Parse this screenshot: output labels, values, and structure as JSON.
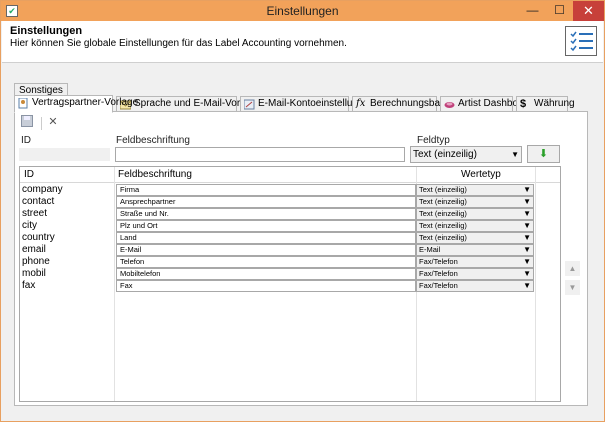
{
  "window": {
    "title": "Einstellungen",
    "minimize": "—",
    "maximize": "☐",
    "close": "✕"
  },
  "header": {
    "title": "Einstellungen",
    "subtitle": "Hier können Sie globale Einstellungen für das Label Accounting vornehmen."
  },
  "tabs": {
    "upper": "Sonstiges",
    "items": [
      {
        "label": "Vertragspartner-Vorlage",
        "icon": "contract-icon"
      },
      {
        "label": "Sprache und E-Mail-Vorlagen",
        "icon": "mail-icon"
      },
      {
        "label": "E-Mail-Kontoeinstellungen",
        "icon": "mail-settings-icon"
      },
      {
        "label": "Berechnungsbasis",
        "icon": "formula-icon"
      },
      {
        "label": "Artist Dashboard",
        "icon": "dashboard-icon"
      },
      {
        "label": "Währung",
        "icon": "dollar-icon"
      }
    ]
  },
  "form": {
    "id_label": "ID",
    "feldbeschriftung_label": "Feldbeschriftung",
    "feldtyp_label": "Feldtyp",
    "feldtyp_value": "Text (einzeilig)"
  },
  "grid": {
    "columns": [
      "ID",
      "Feldbeschriftung",
      "Wertetyp"
    ],
    "rows": [
      {
        "id": "company",
        "label": "Firma",
        "type": "Text (einzeilig)"
      },
      {
        "id": "contact",
        "label": "Ansprechpartner",
        "type": "Text (einzeilig)"
      },
      {
        "id": "street",
        "label": "Straße und Nr.",
        "type": "Text (einzeilig)"
      },
      {
        "id": "city",
        "label": "Plz und Ort",
        "type": "Text (einzeilig)"
      },
      {
        "id": "country",
        "label": "Land",
        "type": "Text (einzeilig)"
      },
      {
        "id": "email",
        "label": "E-Mail",
        "type": "E-Mail"
      },
      {
        "id": "phone",
        "label": "Telefon",
        "type": "Fax/Telefon"
      },
      {
        "id": "mobil",
        "label": "Mobiltelefon",
        "type": "Fax/Telefon"
      },
      {
        "id": "fax",
        "label": "Fax",
        "type": "Fax/Telefon"
      }
    ]
  }
}
